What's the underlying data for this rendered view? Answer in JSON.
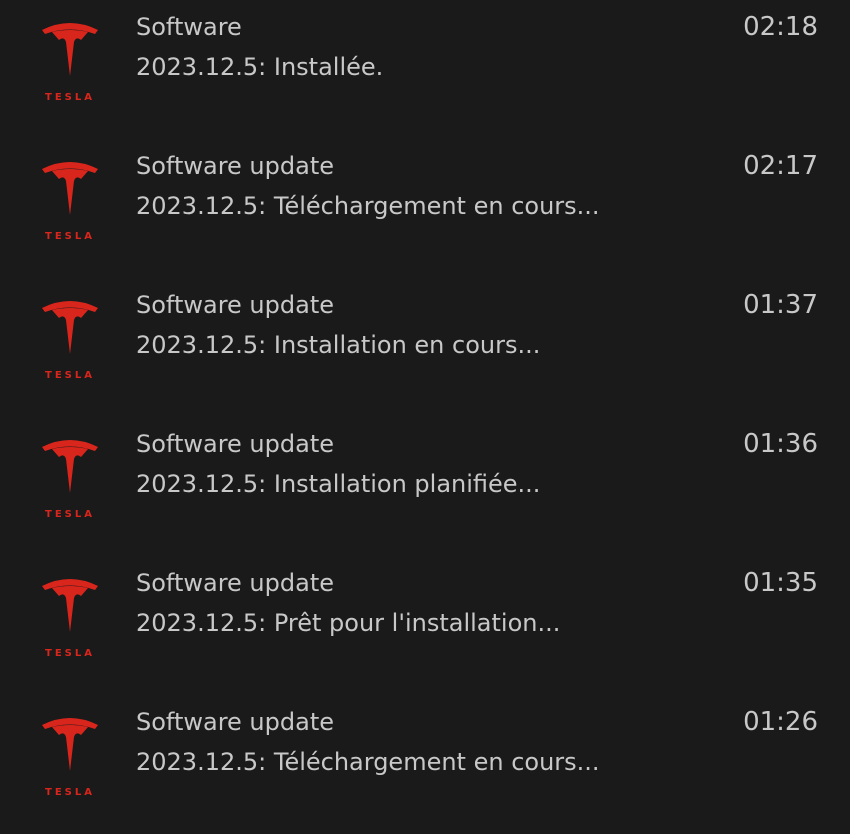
{
  "colors": {
    "background": "#1a1a1a",
    "text": "#c8c8c8",
    "brand": "#d9261c"
  },
  "notifications": [
    {
      "icon": "tesla-logo-icon",
      "logo_text": "TESLA",
      "title": "Software",
      "message": "2023.12.5: Installée.",
      "time": "02:18"
    },
    {
      "icon": "tesla-logo-icon",
      "logo_text": "TESLA",
      "title": "Software update",
      "message": "2023.12.5: Téléchargement en cours...",
      "time": "02:17"
    },
    {
      "icon": "tesla-logo-icon",
      "logo_text": "TESLA",
      "title": "Software update",
      "message": "2023.12.5: Installation en cours...",
      "time": "01:37"
    },
    {
      "icon": "tesla-logo-icon",
      "logo_text": "TESLA",
      "title": "Software update",
      "message": "2023.12.5: Installation planifiée...",
      "time": "01:36"
    },
    {
      "icon": "tesla-logo-icon",
      "logo_text": "TESLA",
      "title": "Software update",
      "message": "2023.12.5: Prêt pour l'installation...",
      "time": "01:35"
    },
    {
      "icon": "tesla-logo-icon",
      "logo_text": "TESLA",
      "title": "Software update",
      "message": "2023.12.5: Téléchargement en cours...",
      "time": "01:26"
    }
  ]
}
